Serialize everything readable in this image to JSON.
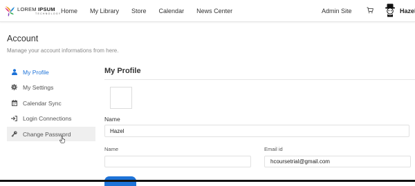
{
  "header": {
    "logo": {
      "brand_light": "LOREM",
      "brand_bold": "IPSUM",
      "tagline": "TECHNOLOGY"
    },
    "nav": [
      "Home",
      "My Library",
      "Store",
      "Calendar",
      "News Center"
    ],
    "admin_link": "Admin Site",
    "cart_icon": "cart-icon",
    "user_name": "Hazel"
  },
  "account": {
    "title": "Account",
    "subtitle": "Manage your account informations from here."
  },
  "sidebar": {
    "items": [
      {
        "label": "My Profile",
        "icon": "user-icon",
        "state": "active"
      },
      {
        "label": "My Settings",
        "icon": "gear-icon",
        "state": ""
      },
      {
        "label": "Calendar Sync",
        "icon": "calendar-icon",
        "state": ""
      },
      {
        "label": "Login Connections",
        "icon": "sign-in-icon",
        "state": ""
      },
      {
        "label": "Change Password",
        "icon": "key-icon",
        "state": "hover"
      }
    ]
  },
  "profile": {
    "title": "My Profile",
    "name_label": "Name",
    "name_value": "Hazel",
    "name2_label": "Name",
    "name2_value": "",
    "email_label": "Email id",
    "email_value": "hcoursetrial@gmail.com"
  },
  "colors": {
    "accent": "#1e73d8",
    "hover_bg": "#efefef",
    "border": "#e1e1e1"
  }
}
